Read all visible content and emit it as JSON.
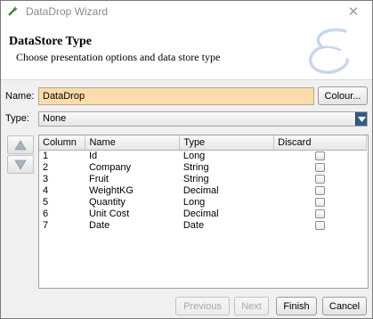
{
  "window": {
    "title": "DataDrop Wizard",
    "close_glyph": "✕"
  },
  "header": {
    "title": "DataStore Type",
    "subtitle": "Choose presentation options and data store type"
  },
  "name_row": {
    "label": "Name:",
    "value": "DataDrop",
    "colour_button": "Colour..."
  },
  "type_row": {
    "label": "Type:",
    "selected": "None"
  },
  "table": {
    "columns": [
      "Column",
      "Name",
      "Type",
      "Discard"
    ],
    "rows": [
      {
        "column": "1",
        "name": "Id",
        "type": "Long",
        "discard": false
      },
      {
        "column": "2",
        "name": "Company",
        "type": "String",
        "discard": false
      },
      {
        "column": "3",
        "name": "Fruit",
        "type": "String",
        "discard": false
      },
      {
        "column": "4",
        "name": "WeightKG",
        "type": "Decimal",
        "discard": false
      },
      {
        "column": "5",
        "name": "Quantity",
        "type": "Long",
        "discard": false
      },
      {
        "column": "6",
        "name": "Unit Cost",
        "type": "Decimal",
        "discard": false
      },
      {
        "column": "7",
        "name": "Date",
        "type": "Date",
        "discard": false
      }
    ]
  },
  "footer": {
    "previous": "Previous",
    "next": "Next",
    "finish": "Finish",
    "cancel": "Cancel"
  },
  "icons": {
    "app": "wizard-app-icon",
    "logo": "wizard-logo-icon",
    "move_up": "triangle-up-icon",
    "move_down": "triangle-down-icon",
    "dropdown": "chevron-down-icon"
  },
  "colors": {
    "name_field_bg": "#fbdcaa",
    "dropdown_arrow_bg": "#2e5c8a"
  }
}
